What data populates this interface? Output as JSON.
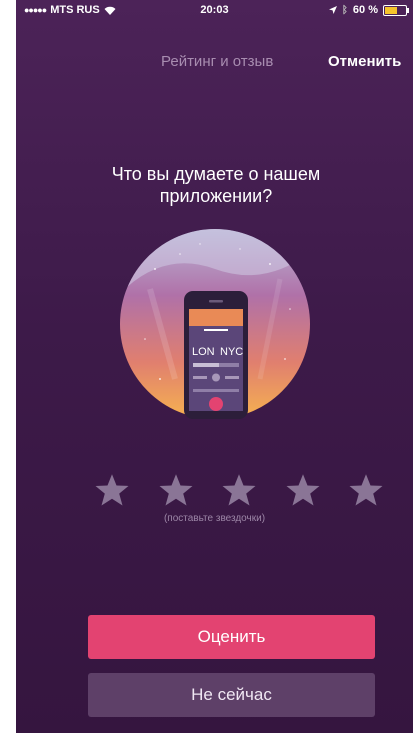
{
  "status_bar": {
    "carrier": "MTS RUS",
    "time": "20:03",
    "battery": "60 %",
    "battery_level": 0.6
  },
  "nav": {
    "title": "Рейтинг и отзыв",
    "cancel": "Отменить"
  },
  "question": "Что вы думаете о нашем приложении?",
  "illustration": {
    "from": "LON",
    "to": "NYC"
  },
  "rating": {
    "max": 5,
    "value": 0,
    "hint": "(поставьте звездочки)"
  },
  "buttons": {
    "rate": "Оценить",
    "later": "Не сейчас"
  },
  "colors": {
    "background": "#3d1a49",
    "accent": "#e34371",
    "secondary_button": "#5e4068",
    "star": "#8a7596"
  }
}
